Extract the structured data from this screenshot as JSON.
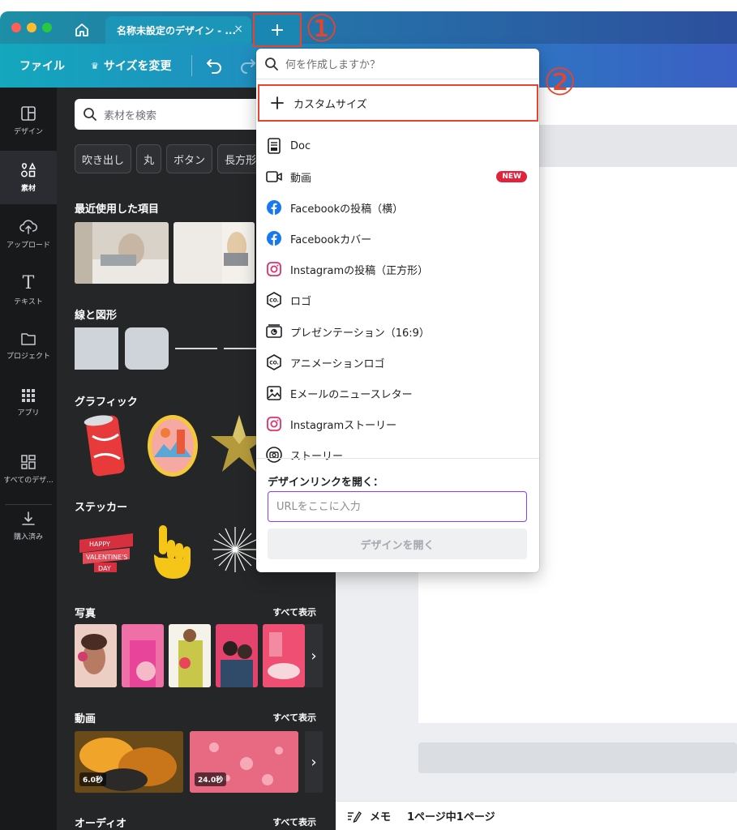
{
  "titlebar": {
    "tab_title": "名称未設定のデザイン - ...",
    "tab_close": "×",
    "new_tab": "+",
    "annotation_1": "①",
    "annotation_2": "②"
  },
  "toolbar": {
    "file_label": "ファイル",
    "resize_label": "サイズを変更",
    "resize_icon": "♛"
  },
  "rail": {
    "items": [
      {
        "label": "デザイン",
        "icon": "design-icon"
      },
      {
        "label": "素材",
        "icon": "elements-icon"
      },
      {
        "label": "アップロード",
        "icon": "upload-icon"
      },
      {
        "label": "テキスト",
        "icon": "text-icon"
      },
      {
        "label": "プロジェクト",
        "icon": "folder-icon"
      },
      {
        "label": "アプリ",
        "icon": "apps-icon"
      },
      {
        "label": "すべてのデザ...",
        "icon": "all-designs-icon"
      },
      {
        "label": "購入済み",
        "icon": "download-icon"
      }
    ],
    "text_icon_glyph": "T"
  },
  "panel": {
    "search_placeholder": "素材を検索",
    "chips": [
      "吹き出し",
      "丸",
      "ボタン",
      "長方形"
    ],
    "sections": {
      "recent": "最近使用した項目",
      "shapes": "線と図形",
      "graphics": "グラフィック",
      "stickers": "ステッカー",
      "photos": "写真",
      "videos": "動画",
      "audio": "オーディオ"
    },
    "see_all": "すべて表示",
    "video_durations": [
      "6.0秒",
      "24.0秒"
    ],
    "chevron": "›"
  },
  "dropdown": {
    "search_placeholder": "何を作成しますか？",
    "items": [
      {
        "label": "カスタムサイズ",
        "icon": "plus-icon"
      },
      {
        "label": "Doc",
        "icon": "doc-icon"
      },
      {
        "label": "動画",
        "icon": "video-icon",
        "badge": "NEW"
      },
      {
        "label": "Facebookの投稿（横）",
        "icon": "facebook-icon"
      },
      {
        "label": "Facebookカバー",
        "icon": "facebook-icon"
      },
      {
        "label": "Instagramの投稿（正方形）",
        "icon": "instagram-icon"
      },
      {
        "label": "ロゴ",
        "icon": "logo-icon"
      },
      {
        "label": "プレゼンテーション（16:9）",
        "icon": "presentation-icon"
      },
      {
        "label": "アニメーションロゴ",
        "icon": "logo-icon"
      },
      {
        "label": "Eメールのニュースレター",
        "icon": "image-icon"
      },
      {
        "label": "Instagramストーリー",
        "icon": "instagram-icon"
      },
      {
        "label": "ストーリー",
        "icon": "camera-icon"
      }
    ],
    "link_title": "デザインリンクを開く：",
    "url_placeholder": "URLをここに入力",
    "open_button": "デザインを開く",
    "logo_text": "CO."
  },
  "footer": {
    "memo_label": "メモ",
    "page_label": "1ページ中1ページ"
  },
  "colors": {
    "annotation": "#e8432e",
    "rail_bg": "#18191b",
    "panel_bg": "#252627",
    "new_badge": "#e0243c",
    "facebook": "#1877f2",
    "url_border": "#8b3dff"
  }
}
